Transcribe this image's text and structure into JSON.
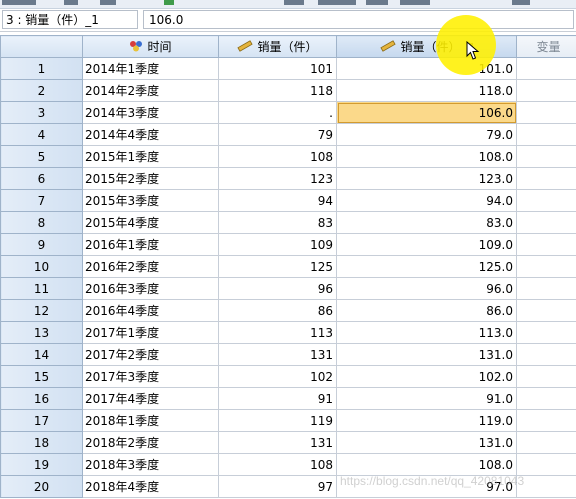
{
  "cell_bar": {
    "reference": "3 : 销量（件）_1",
    "value": "106.0"
  },
  "columns": {
    "rownum": "",
    "time": "时间",
    "sales": "销量（件）",
    "sales_1": "销量（件）",
    "empty": "变量"
  },
  "rows": [
    {
      "n": "1",
      "time": "2014年1季度",
      "sales": "101",
      "sales_1": "101.0"
    },
    {
      "n": "2",
      "time": "2014年2季度",
      "sales": "118",
      "sales_1": "118.0"
    },
    {
      "n": "3",
      "time": "2014年3季度",
      "sales": ".",
      "sales_1": "106.0"
    },
    {
      "n": "4",
      "time": "2014年4季度",
      "sales": "79",
      "sales_1": "79.0"
    },
    {
      "n": "5",
      "time": "2015年1季度",
      "sales": "108",
      "sales_1": "108.0"
    },
    {
      "n": "6",
      "time": "2015年2季度",
      "sales": "123",
      "sales_1": "123.0"
    },
    {
      "n": "7",
      "time": "2015年3季度",
      "sales": "94",
      "sales_1": "94.0"
    },
    {
      "n": "8",
      "time": "2015年4季度",
      "sales": "83",
      "sales_1": "83.0"
    },
    {
      "n": "9",
      "time": "2016年1季度",
      "sales": "109",
      "sales_1": "109.0"
    },
    {
      "n": "10",
      "time": "2016年2季度",
      "sales": "125",
      "sales_1": "125.0"
    },
    {
      "n": "11",
      "time": "2016年3季度",
      "sales": "96",
      "sales_1": "96.0"
    },
    {
      "n": "12",
      "time": "2016年4季度",
      "sales": "86",
      "sales_1": "86.0"
    },
    {
      "n": "13",
      "time": "2017年1季度",
      "sales": "113",
      "sales_1": "113.0"
    },
    {
      "n": "14",
      "time": "2017年2季度",
      "sales": "131",
      "sales_1": "131.0"
    },
    {
      "n": "15",
      "time": "2017年3季度",
      "sales": "102",
      "sales_1": "102.0"
    },
    {
      "n": "16",
      "time": "2017年4季度",
      "sales": "91",
      "sales_1": "91.0"
    },
    {
      "n": "17",
      "time": "2018年1季度",
      "sales": "119",
      "sales_1": "119.0"
    },
    {
      "n": "18",
      "time": "2018年2季度",
      "sales": "131",
      "sales_1": "131.0"
    },
    {
      "n": "19",
      "time": "2018年3季度",
      "sales": "108",
      "sales_1": "108.0"
    },
    {
      "n": "20",
      "time": "2018年4季度",
      "sales": "97",
      "sales_1": "97.0"
    }
  ],
  "selected_row": "3",
  "watermark": "https://blog.csdn.net/qq_42081043",
  "colors": {
    "selected_cell": "#fbd98a",
    "cursor_highlight": "#fff000",
    "header": "#d5e3f3"
  },
  "icons": {
    "time": "nominal-measure-icon",
    "sales": "scale-measure-icon",
    "sales_1": "scale-measure-icon"
  }
}
